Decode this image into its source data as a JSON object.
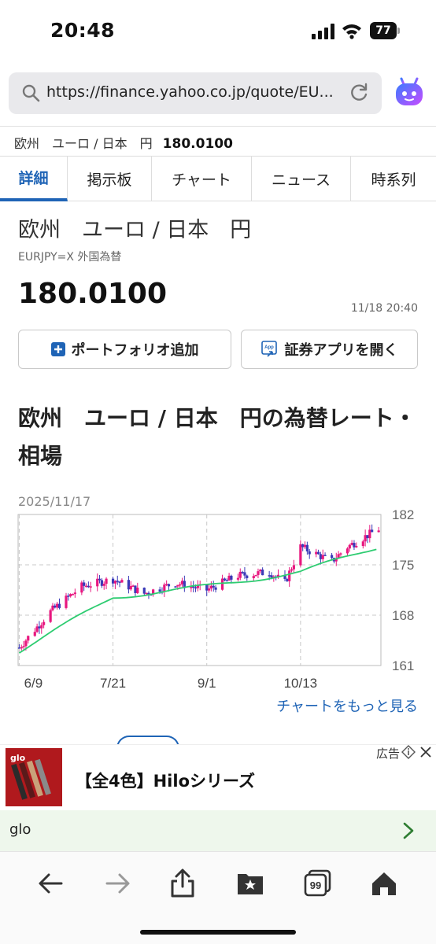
{
  "status_bar": {
    "time": "20:48",
    "battery": "77"
  },
  "browser": {
    "url": "https://finance.yahoo.co.jp/quote/EU..."
  },
  "quote_header": {
    "name": "欧州　ユーロ / 日本　円",
    "price": "180.0100"
  },
  "tabs": [
    {
      "label": "詳細",
      "active": true
    },
    {
      "label": "掲示板"
    },
    {
      "label": "チャート"
    },
    {
      "label": "ニュース"
    },
    {
      "label": "時系列"
    }
  ],
  "main": {
    "title": "欧州　ユーロ / 日本　円",
    "subtitle": "EURJPY=X 外国為替",
    "price": "180.0100",
    "timestamp": "11/18 20:40",
    "portfolio_button": "ポートフォリオ追加",
    "app_button": "証券アプリを開く",
    "section_title": "欧州　ユーロ / 日本　円の為替レート・相場",
    "more_chart_link": "チャートをもっと見る"
  },
  "chart_data": {
    "type": "candlestick",
    "date_label": "2025/11/17",
    "x_ticks": [
      "6/9",
      "7/21",
      "9/1",
      "10/13"
    ],
    "y_ticks": [
      182,
      175,
      168,
      161
    ],
    "ylim": [
      161,
      182
    ],
    "grid": true,
    "close_approx": [
      {
        "date": "6/9",
        "value": 163.5
      },
      {
        "date": "6/23",
        "value": 168.5
      },
      {
        "date": "7/7",
        "value": 172.0
      },
      {
        "date": "7/21",
        "value": 173.0
      },
      {
        "date": "8/4",
        "value": 171.0
      },
      {
        "date": "8/18",
        "value": 172.5
      },
      {
        "date": "9/1",
        "value": 171.5
      },
      {
        "date": "9/15",
        "value": 173.5
      },
      {
        "date": "9/29",
        "value": 174.0
      },
      {
        "date": "10/6",
        "value": 172.5
      },
      {
        "date": "10/13",
        "value": 177.5
      },
      {
        "date": "10/27",
        "value": 175.5
      },
      {
        "date": "11/3",
        "value": 177.5
      },
      {
        "date": "11/17",
        "value": 180.0
      }
    ],
    "moving_average_approx": [
      {
        "date": "6/9",
        "value": 163.0
      },
      {
        "date": "7/21",
        "value": 170.5
      },
      {
        "date": "9/1",
        "value": 172.0
      },
      {
        "date": "10/13",
        "value": 174.0
      },
      {
        "date": "11/17",
        "value": 177.5
      }
    ],
    "colors": {
      "up": "#e8177f",
      "down": "#3a3ab8",
      "ma": "#2ecc71",
      "grid": "#c8c8c8"
    }
  },
  "ad": {
    "label": "広告",
    "title": "【全4色】Hiloシリーズ",
    "brand": "glo",
    "image_text": "glo"
  },
  "toolbar": {
    "icons": [
      "back-icon",
      "forward-icon",
      "share-icon",
      "bookmarks-icon",
      "tabs-icon",
      "home-icon"
    ],
    "tabs_count": "99"
  }
}
